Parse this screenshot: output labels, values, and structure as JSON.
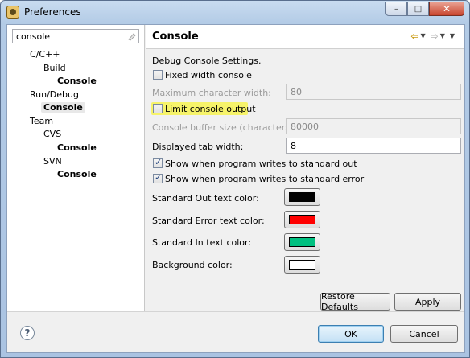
{
  "window": {
    "title": "Preferences",
    "minimize": "–",
    "maximize": "□",
    "close": "✕"
  },
  "filter": {
    "value": "console"
  },
  "tree": [
    {
      "label": "C/C++",
      "bold": false
    },
    {
      "label": "Build",
      "bold": false
    },
    {
      "label": "Console",
      "bold": true
    },
    {
      "label": "Run/Debug",
      "bold": false
    },
    {
      "label": "Console",
      "bold": true
    },
    {
      "label": "Team",
      "bold": false
    },
    {
      "label": "CVS",
      "bold": false
    },
    {
      "label": "Console",
      "bold": true
    },
    {
      "label": "SVN",
      "bold": false
    },
    {
      "label": "Console",
      "bold": true
    }
  ],
  "page": {
    "title": "Console",
    "description": "Debug Console Settings.",
    "fixed_width": {
      "label": "Fixed width console",
      "checked": false
    },
    "max_char_width": {
      "label": "Maximum character width:",
      "value": "80"
    },
    "limit_output": {
      "label": "Limit console output",
      "checked": false
    },
    "buffer_size": {
      "label": "Console buffer size (characters):",
      "value": "80000"
    },
    "tab_width": {
      "label": "Displayed tab width:",
      "value": "8"
    },
    "show_stdout": {
      "label": "Show when program writes to standard out",
      "checked": true
    },
    "show_stderr": {
      "label": "Show when program writes to standard error",
      "checked": true
    },
    "colors": [
      {
        "label": "Standard Out text color:",
        "color": "#000000"
      },
      {
        "label": "Standard Error text color:",
        "color": "#ff0000"
      },
      {
        "label": "Standard In text color:",
        "color": "#00c080"
      },
      {
        "label": "Background color:",
        "color": "#ffffff"
      }
    ],
    "restore_defaults": "Restore Defaults",
    "apply": "Apply"
  },
  "footer": {
    "help": "?",
    "ok": "OK",
    "cancel": "Cancel"
  },
  "accent": {
    "highlight": "#f6f36a"
  }
}
